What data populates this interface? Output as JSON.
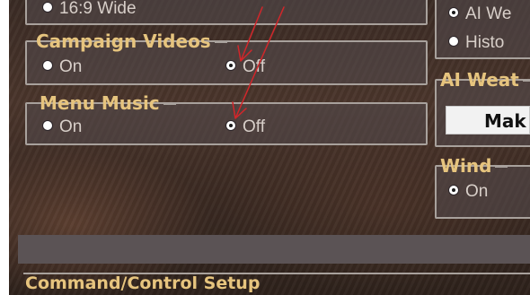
{
  "top_left_option": "16:9 Wide",
  "campaign_videos": {
    "title": "Campaign Videos",
    "on": "On",
    "off": "Off",
    "selected": "off"
  },
  "menu_music": {
    "title": "Menu Music",
    "on": "On",
    "off": "Off",
    "selected": "off"
  },
  "right_top": {
    "ai_label": "AI We",
    "history_label": "Histo"
  },
  "ai_weather": {
    "title": "AI Weat",
    "button": "Mak"
  },
  "wind": {
    "title": "Wind",
    "on": "On",
    "selected": "on"
  },
  "command": {
    "title": "Command/Control Setup"
  },
  "colors": {
    "gold": "#e6c47e",
    "annotation_red": "#d2262a",
    "panel_border": "#a8a19c"
  }
}
